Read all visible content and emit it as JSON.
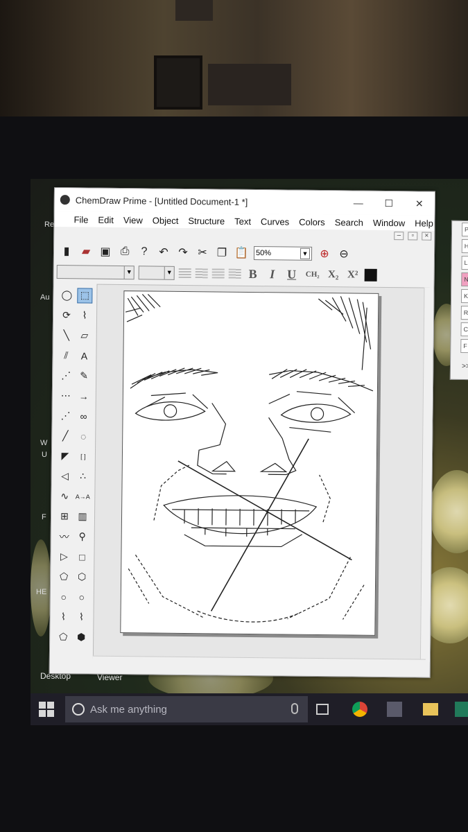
{
  "window": {
    "title": "ChemDraw Prime - [Untitled Document-1 *]",
    "controls": [
      "—",
      "☐",
      "✕"
    ]
  },
  "menu": [
    "File",
    "Edit",
    "View",
    "Object",
    "Structure",
    "Text",
    "Curves",
    "Colors",
    "Search",
    "Window",
    "Help"
  ],
  "mdi_controls": [
    "–",
    "▫",
    "×"
  ],
  "toolbar": {
    "zoom_value": "50%"
  },
  "format_bar": {
    "bold": "B",
    "italic": "I",
    "underline": "U",
    "ch2": "CH₂",
    "subscript": "X₂",
    "superscript": "X²"
  },
  "palette_tools": [
    {
      "icon": "lasso-icon"
    },
    {
      "icon": "marquee-select-icon"
    },
    {
      "icon": "rotate-icon"
    },
    {
      "icon": "chain-icon"
    },
    {
      "icon": "single-bond-icon"
    },
    {
      "icon": "eraser-icon"
    },
    {
      "icon": "double-bond-icon",
      "text": ""
    },
    {
      "icon": "text-tool-icon",
      "text": "A"
    },
    {
      "icon": "dashed-bond-icon"
    },
    {
      "icon": "pen-icon"
    },
    {
      "icon": "hashed-bond-icon"
    },
    {
      "icon": "arrow-icon"
    },
    {
      "icon": "wedge-hash-icon"
    },
    {
      "icon": "orbital-icon"
    },
    {
      "icon": "bold-bond-icon"
    },
    {
      "icon": "dashed-circle-icon"
    },
    {
      "icon": "wedge-bond-icon"
    },
    {
      "icon": "bracket-icon",
      "text": "[ ]"
    },
    {
      "icon": "hollow-wedge-icon"
    },
    {
      "icon": "dots-icon"
    },
    {
      "icon": "wavy-bond-icon"
    },
    {
      "icon": "atom-map-icon",
      "text": "A→A"
    },
    {
      "icon": "table-icon"
    },
    {
      "icon": "tlc-plate-icon"
    },
    {
      "icon": "query-icon"
    },
    {
      "icon": "stamp-icon"
    },
    {
      "icon": "triangle-icon"
    },
    {
      "icon": "square-icon"
    },
    {
      "icon": "pentagon-icon"
    },
    {
      "icon": "hexagon-icon"
    },
    {
      "icon": "heptagon-icon"
    },
    {
      "icon": "octagon-icon"
    },
    {
      "icon": "chair-icon"
    },
    {
      "icon": "chair2-icon"
    },
    {
      "icon": "cyclopentane-icon"
    },
    {
      "icon": "benzene-icon"
    }
  ],
  "desktop": {
    "labels": [
      "Desktop",
      "Viewer"
    ],
    "icon_fragments": [
      "Re",
      "Au",
      "W",
      "U",
      "F",
      "HE"
    ]
  },
  "taskbar": {
    "search_placeholder": "Ask me anything"
  },
  "side_panel": {
    "rows": [
      "H",
      "L",
      "N",
      "K",
      "Rl",
      "C",
      "F"
    ],
    "expander": ">>",
    "header": "Pe"
  }
}
